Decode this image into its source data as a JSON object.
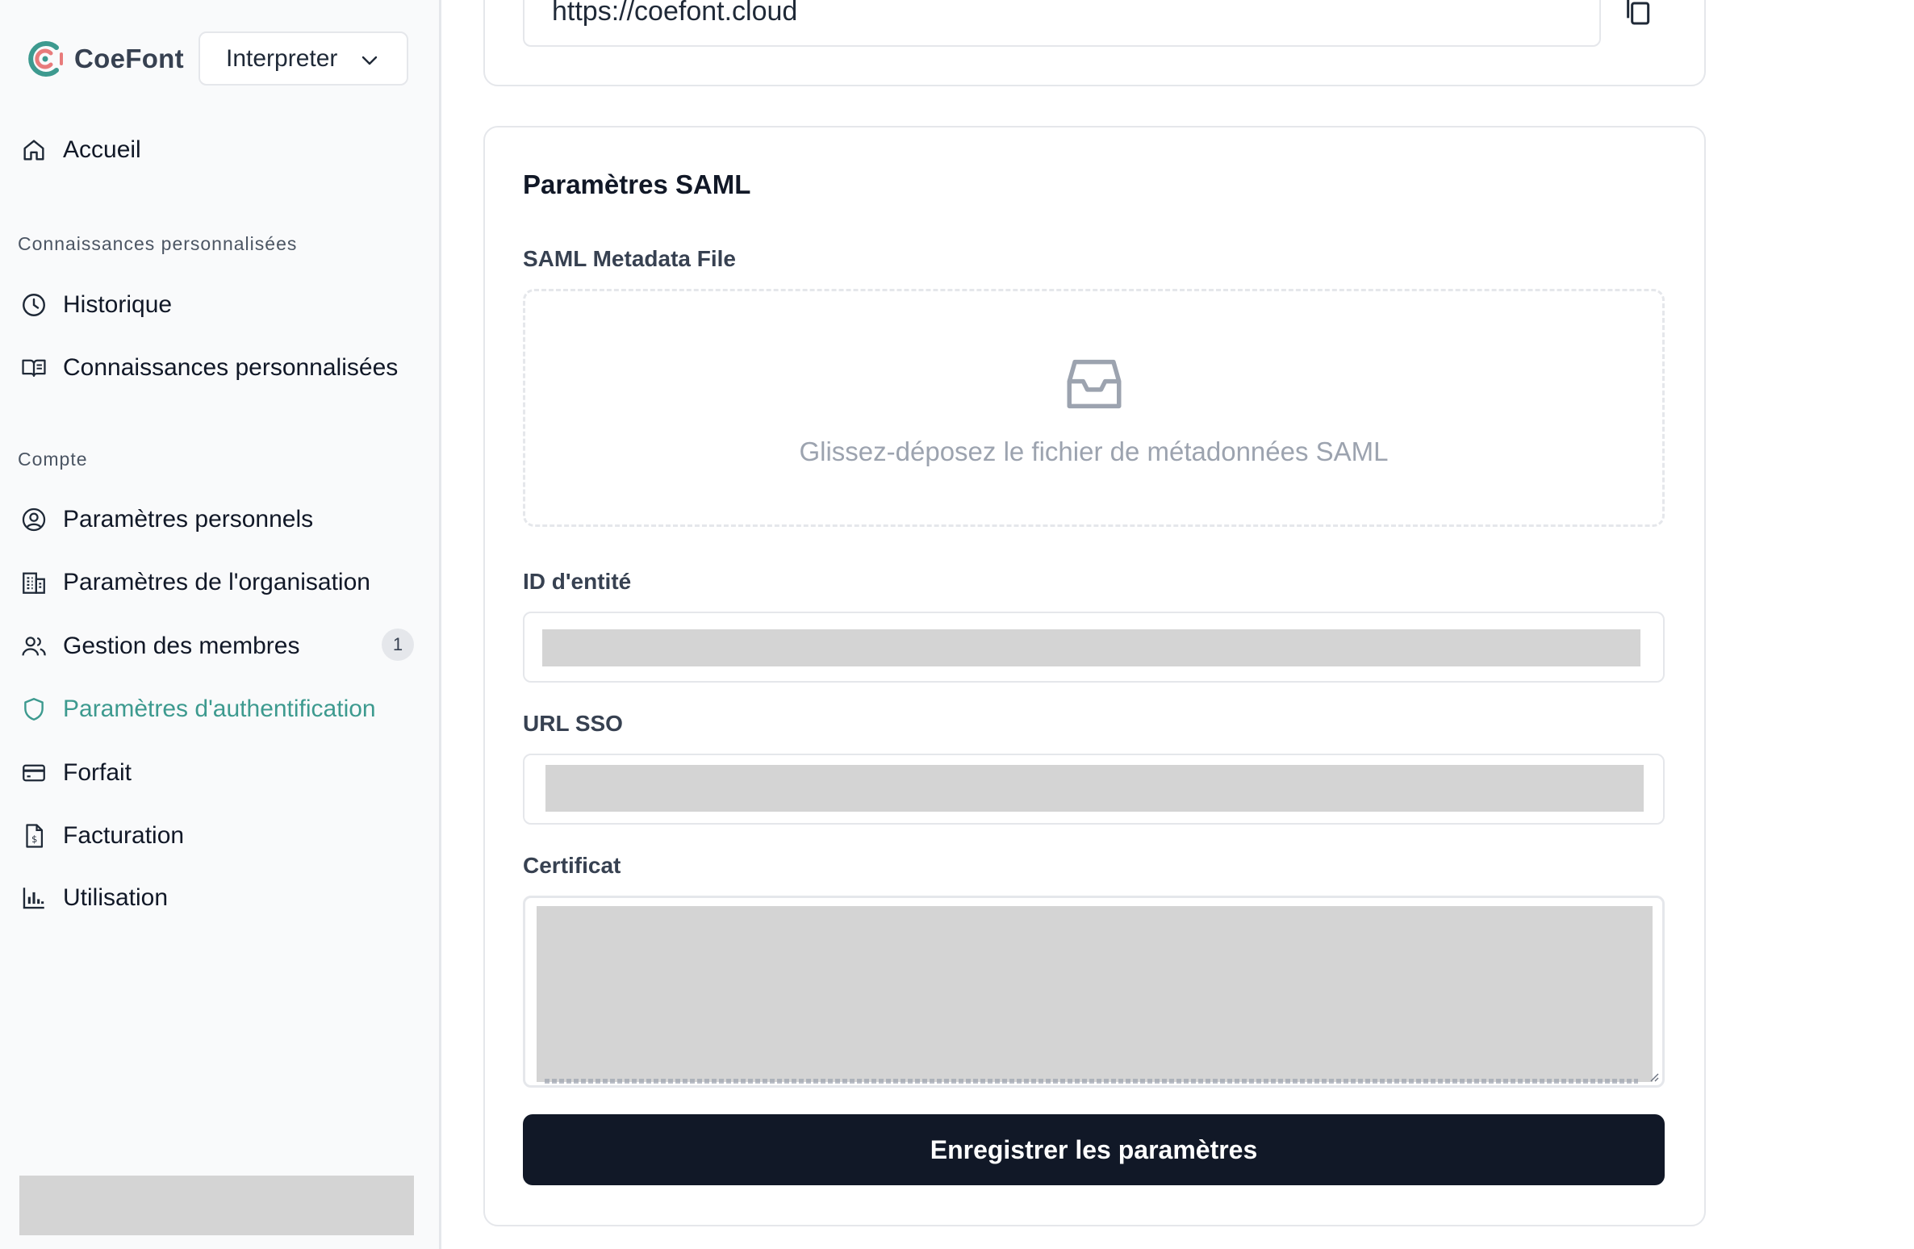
{
  "app": {
    "name": "CoeFont"
  },
  "mode_select": {
    "value": "Interpreter"
  },
  "sidebar": {
    "home": "Accueil",
    "section_knowledge": "Connaissances personnalisées",
    "history": "Historique",
    "custom_knowledge": "Connaissances personnalisées",
    "section_account": "Compte",
    "personal_settings": "Paramètres personnels",
    "org_settings": "Paramètres de l'organisation",
    "members": "Gestion des membres",
    "members_badge": "1",
    "auth_settings": "Paramètres d'authentification",
    "plan": "Forfait",
    "billing": "Facturation",
    "usage": "Utilisation"
  },
  "url_card": {
    "url": "https://coefont.cloud"
  },
  "saml": {
    "title": "Paramètres SAML",
    "metadata_label": "SAML Metadata File",
    "dropzone_hint": "Glissez-déposez le fichier de métadonnées SAML",
    "entity_id_label": "ID d'entité",
    "sso_url_label": "URL SSO",
    "certificate_label": "Certificat",
    "save_button": "Enregistrer les paramètres"
  },
  "colors": {
    "accent": "#3d9a8f",
    "primary_button": "#111827",
    "sidebar_bg": "#f9fafb",
    "redacted": "#d4d4d4"
  }
}
